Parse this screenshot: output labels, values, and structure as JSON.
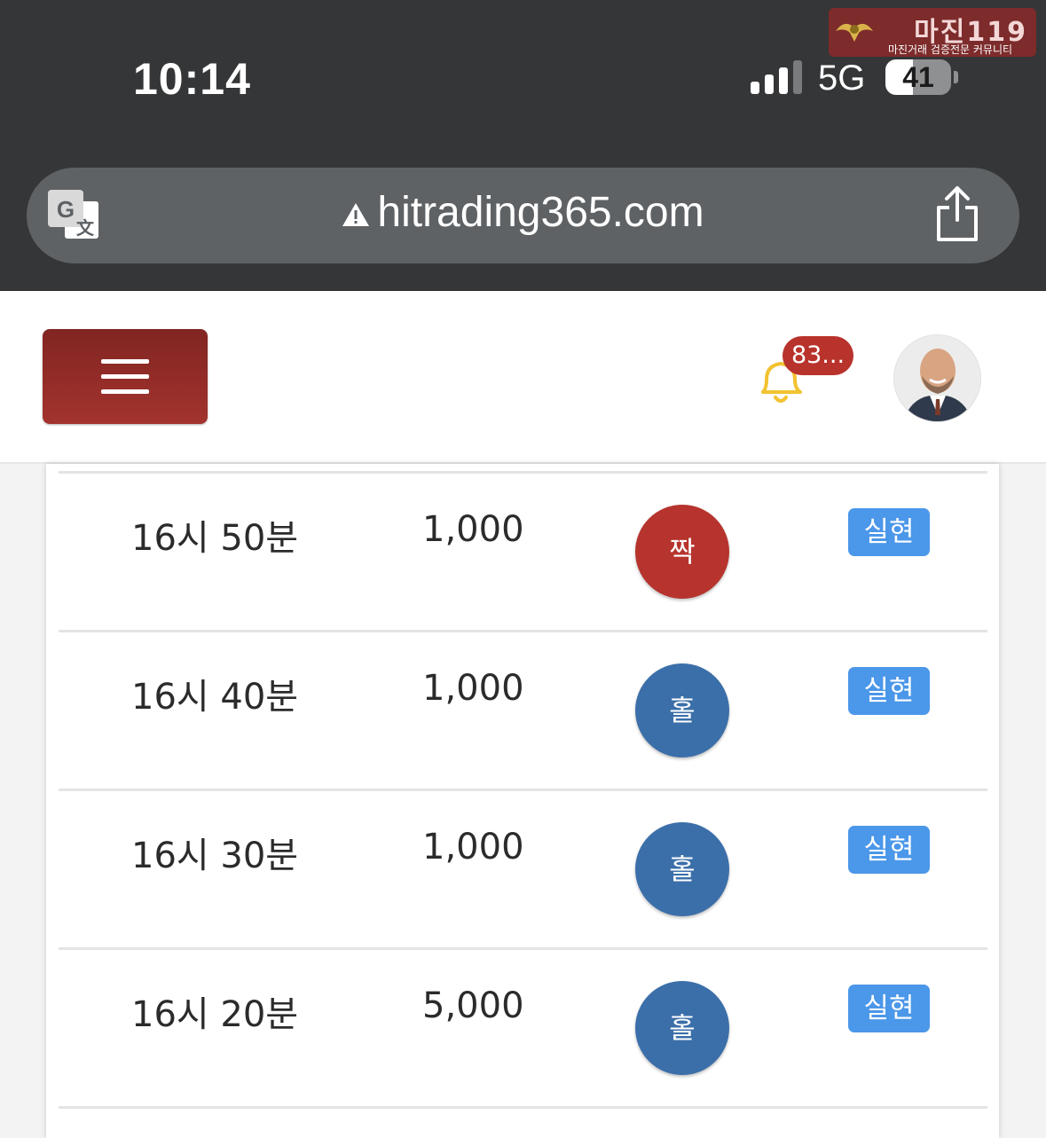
{
  "status_bar": {
    "time": "10:14",
    "network": "5G",
    "battery": "41"
  },
  "watermark": {
    "title": "마진119",
    "subtitle": "마진거래 검증전문 커뮤니티"
  },
  "browser": {
    "url": "hitrading365.com"
  },
  "header": {
    "notification_count": "83..."
  },
  "colors": {
    "brand_red": "#a3332d",
    "odd_blue": "#3b6fa9",
    "status_blue": "#4b97e9"
  },
  "rows": [
    {
      "time": "16시 50분",
      "amount": "1,000",
      "pick": "짝",
      "pick_color": "red",
      "status": "실현"
    },
    {
      "time": "16시 40분",
      "amount": "1,000",
      "pick": "홀",
      "pick_color": "blue",
      "status": "실현"
    },
    {
      "time": "16시 30분",
      "amount": "1,000",
      "pick": "홀",
      "pick_color": "blue",
      "status": "실현"
    },
    {
      "time": "16시 20분",
      "amount": "5,000",
      "pick": "홀",
      "pick_color": "blue",
      "status": "실현"
    }
  ]
}
